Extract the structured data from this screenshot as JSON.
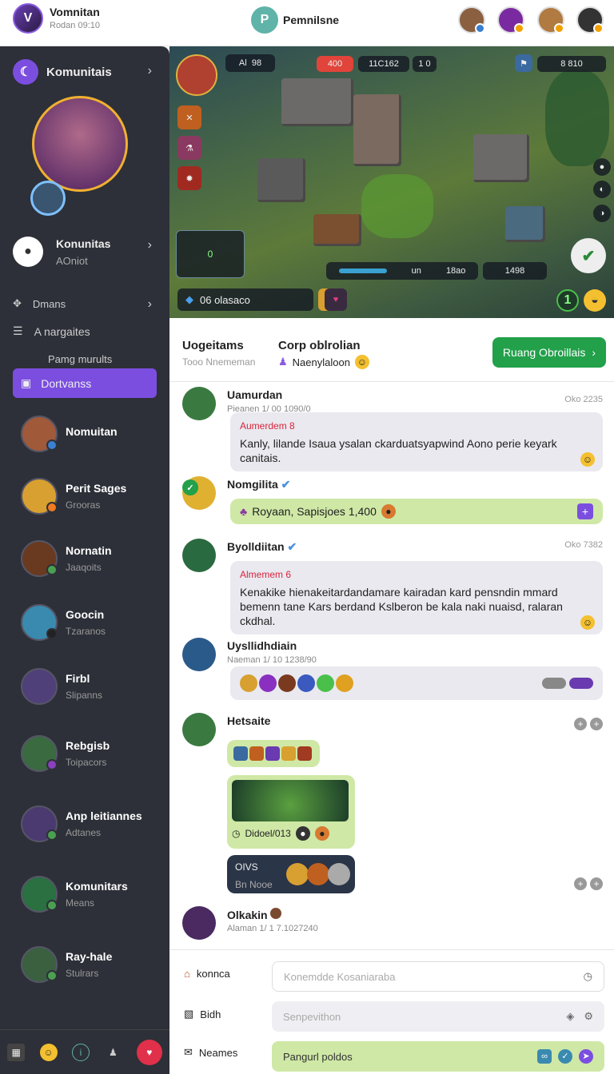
{
  "header": {
    "user_name": "Vomnitan",
    "user_status": "Rodan 09:10",
    "center_title": "Pemnilsne"
  },
  "sidebar": {
    "title": "Komunitais",
    "profile_hint": "",
    "community": {
      "name": "Konunitas",
      "sub": "AOniot"
    },
    "menu": [
      {
        "label": "Dmans"
      },
      {
        "label": "A nargaites"
      },
      {
        "label": "Pamg murults"
      }
    ],
    "active_item": "Dortvanss",
    "contacts": [
      {
        "name": "Nomuitan",
        "sub": ""
      },
      {
        "name": "Perit Sages",
        "sub": "Grooras"
      },
      {
        "name": "Nornatin",
        "sub": "Jaaqoits"
      },
      {
        "name": "Goocin",
        "sub": "Tzaranos"
      },
      {
        "name": "Firbl",
        "sub": "Slipanns"
      },
      {
        "name": "Rebgisb",
        "sub": "Toipacors"
      },
      {
        "name": "Anp leitiannes",
        "sub": "Adtanes"
      },
      {
        "name": "Komunitars",
        "sub": "Means"
      },
      {
        "name": "Ray-hale",
        "sub": "Stulrars"
      }
    ]
  },
  "game": {
    "hud_left": "Al",
    "hud_left2": "98",
    "hud_top": "400",
    "hud_mid": "11C162",
    "hud_mid2": "1 0",
    "hud_right": "8 810",
    "bar_a": "un",
    "bar_b": "18ao",
    "bar_c": "1498",
    "bottom_label": "06 olasaco",
    "level_badge": "1",
    "skill_a": "0"
  },
  "group": {
    "col1_title": "Uogeitams",
    "col1_sub": "Tooo Nnememan",
    "col2_title": "Corp oblrolian",
    "col2_sub": "Naenylaloon",
    "cta": "Ruang Obroillais"
  },
  "messages": [
    {
      "name": "Uamurdan",
      "meta": "Pieanen 1/ 00 1090/0",
      "time": "Oko 2235",
      "highlight": "Aumerdem 8",
      "text": "Kanly, lilande Isaua ysalan ckarduatsyapwind Aono perie keyark canitais."
    },
    {
      "name": "Nomgilita",
      "text": "Royaan, Sapisjoes 1,400"
    },
    {
      "name": "Byolldiitan",
      "time": "Oko 7382",
      "highlight": "Almemem 6",
      "text": "Kenakike hienakeitardandamare kairadan kard pensndin mmard bemenn tane Kars berdand Kslberon be kala naki nuaisd, ralaran ckdhal."
    },
    {
      "name": "Uysllidhdiain",
      "meta": "Naeman 1/ 10 1238/90"
    },
    {
      "name": "Hetsaite",
      "image_caption": "Didoel/013",
      "card_title": "OIVS",
      "card_sub": "Bn Nooe"
    },
    {
      "name": "Olkakin",
      "meta": "Alaman 1/ 1 7.1027240"
    }
  ],
  "composer": {
    "row1_label": "konnca",
    "row1_placeholder": "Konemdde Kosaniaraba",
    "row2_label": "Bidh",
    "row2_placeholder": "Senpevithon",
    "row3_label": "Neames",
    "row3_value": "Pangurl poldos"
  },
  "colors": {
    "accent": "#7b4ee0",
    "green": "#22a04a",
    "bubble": "#e9e9ef",
    "bubble_green": "#cfe8a6",
    "sidebar": "#2d3038"
  }
}
